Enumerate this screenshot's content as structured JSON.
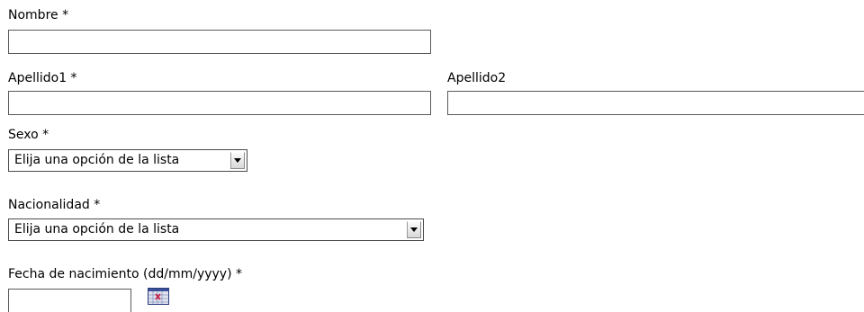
{
  "form": {
    "nombre": {
      "label": "Nombre *",
      "value": ""
    },
    "apellido1": {
      "label": "Apellido1 *",
      "value": ""
    },
    "apellido2": {
      "label": "Apellido2",
      "value": ""
    },
    "sexo": {
      "label": "Sexo *",
      "selected": "Elija una opción de la lista"
    },
    "nacionalidad": {
      "label": "Nacionalidad *",
      "selected": "Elija una opción de la lista"
    },
    "fecha_nacimiento": {
      "label": "Fecha de nacimiento (dd/mm/yyyy) *",
      "value": "",
      "calendar_icon": "calendar-icon"
    }
  },
  "colors": {
    "field_border": "#5a5a5a",
    "calendar_accent": "#c8264a"
  }
}
